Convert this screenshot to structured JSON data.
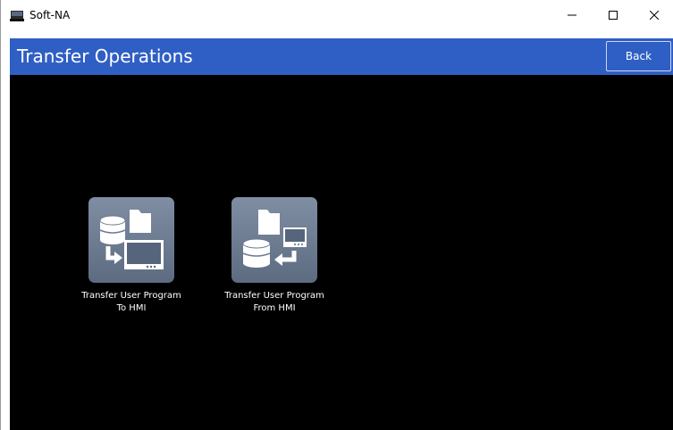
{
  "window": {
    "title": "Soft-NA",
    "app_icon": "hmi-monitor-icon",
    "controls": {
      "minimize_icon": "minimize-icon",
      "maximize_icon": "maximize-icon",
      "close_icon": "close-icon"
    }
  },
  "header": {
    "title": "Transfer Operations",
    "back_label": "Back",
    "color": "#2f5fc4"
  },
  "content": {
    "background": "#000000",
    "tiles": [
      {
        "line1": "Transfer User Program",
        "line2": "To HMI",
        "icon": "transfer-to-hmi-icon"
      },
      {
        "line1": "Transfer User Program",
        "line2": "From HMI",
        "icon": "transfer-from-hmi-icon"
      }
    ]
  }
}
